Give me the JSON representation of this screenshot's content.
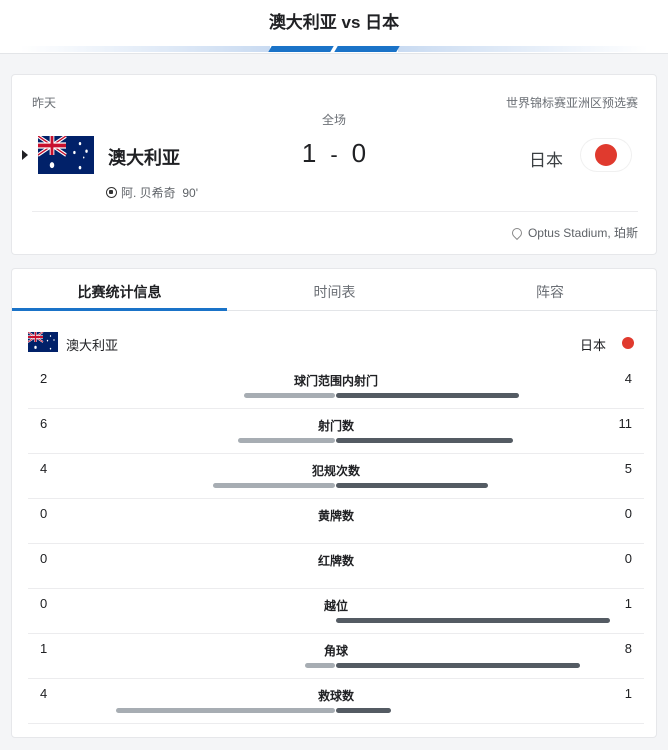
{
  "header": {
    "title": "澳大利亚 vs 日本"
  },
  "match": {
    "when": "昨天",
    "competition": "世界锦标赛亚洲区预选赛",
    "period": "全场",
    "home": {
      "name": "澳大利亚",
      "score": "1",
      "flag": "australia-flag"
    },
    "away": {
      "name": "日本",
      "score": "0",
      "flag": "japan-flag"
    },
    "separator": "-",
    "scorer": {
      "name": "阿. 贝希奇",
      "minute": "90'"
    },
    "venue": "Optus Stadium, 珀斯"
  },
  "tabs": [
    {
      "label": "比赛统计信息",
      "active": true
    },
    {
      "label": "时间表",
      "active": false
    },
    {
      "label": "阵容",
      "active": false
    }
  ],
  "stats_header": {
    "home": "澳大利亚",
    "away": "日本"
  },
  "stats": [
    {
      "label": "球门范围内射门",
      "home": "2",
      "away": "4"
    },
    {
      "label": "射门数",
      "home": "6",
      "away": "11"
    },
    {
      "label": "犯规次数",
      "home": "4",
      "away": "5"
    },
    {
      "label": "黄牌数",
      "home": "0",
      "away": "0"
    },
    {
      "label": "红牌数",
      "home": "0",
      "away": "0"
    },
    {
      "label": "越位",
      "home": "0",
      "away": "1"
    },
    {
      "label": "角球",
      "home": "1",
      "away": "8"
    },
    {
      "label": "救球数",
      "home": "4",
      "away": "1"
    }
  ],
  "colors": {
    "accent": "#1a73c8",
    "home_bar": "#a7adb3",
    "away_bar": "#545b63",
    "japan_red": "#e03a2e"
  }
}
